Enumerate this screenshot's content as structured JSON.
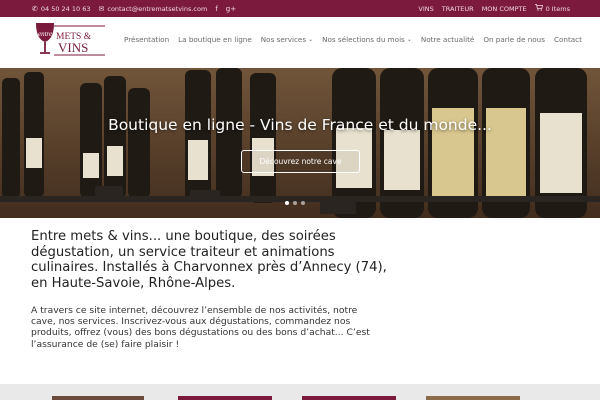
{
  "topbar": {
    "phone": "04 50 24 10 63",
    "email": "contact@entrematsetvins.com",
    "facebook_glyph": "f",
    "googleplus_glyph": "g+",
    "links": [
      "VINS",
      "TRAITEUR",
      "MON COMPTE"
    ],
    "cart": "0 Items",
    "bg_color": "#7b1a3c"
  },
  "logo": {
    "word1": "entre",
    "word2": "METS &",
    "word3": "VINS",
    "color": "#7b1a3c"
  },
  "nav": {
    "items": [
      {
        "label": "Présentation",
        "dropdown": false
      },
      {
        "label": "La boutique en ligne",
        "dropdown": false
      },
      {
        "label": "Nos services",
        "dropdown": true
      },
      {
        "label": "Nos sélections du mois",
        "dropdown": true
      },
      {
        "label": "Notre actualité",
        "dropdown": false
      },
      {
        "label": "On parle de nous",
        "dropdown": false
      },
      {
        "label": "Contact",
        "dropdown": false
      }
    ]
  },
  "hero": {
    "title": "Boutique en ligne - Vins de France et du monde...",
    "button": "Découvrez notre cave",
    "slides": 3,
    "active_slide": 0
  },
  "intro": {
    "title": "Entre mets & vins... une boutique, des soirées dégustation, un service traiteur et animations culinaires. Installés à Charvonnex près d’Annecy (74), en Haute-Savoie, Rhône-Alpes.",
    "body": "A travers ce site internet, découvrez l’ensemble de nos activités, notre cave, nos services. Inscrivez-vous aux dégustations, commandez nos produits, offrez (vous) des bons dégustations ou des bons d’achat... C’est l’assurance de (se) faire plaisir !"
  }
}
